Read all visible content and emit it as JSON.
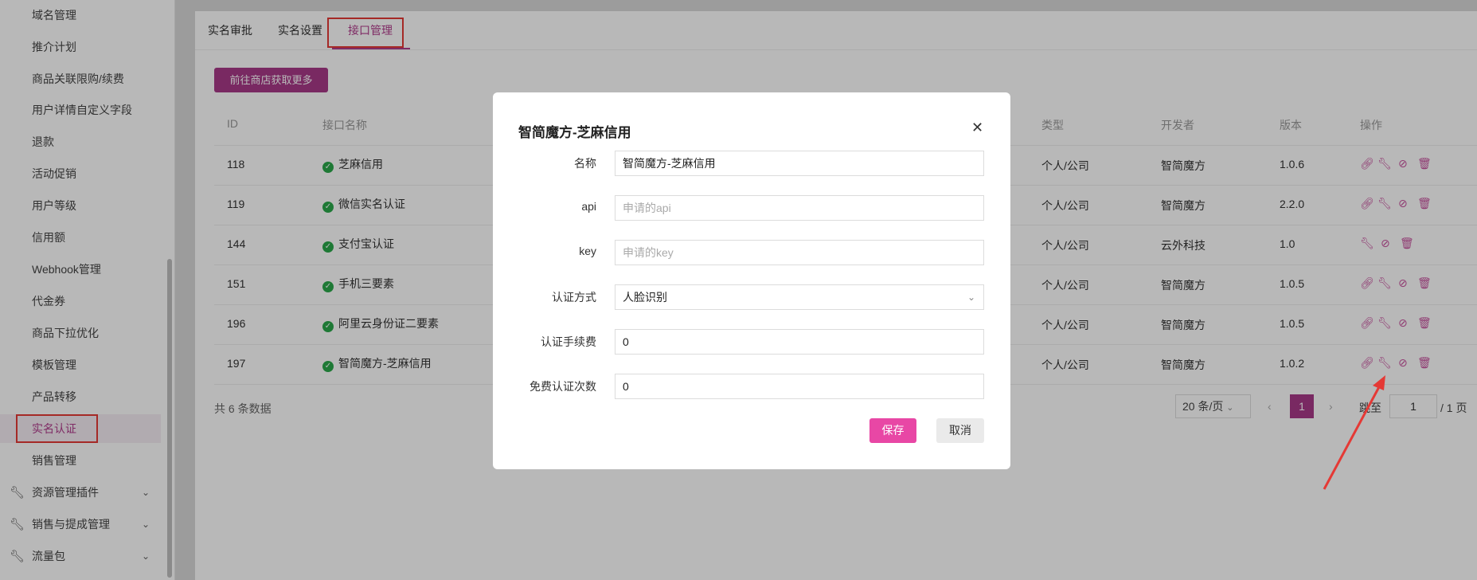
{
  "sidebar": {
    "items": [
      {
        "label": "域名管理"
      },
      {
        "label": "推介计划"
      },
      {
        "label": "商品关联限购/续费"
      },
      {
        "label": "用户详情自定义字段"
      },
      {
        "label": "退款"
      },
      {
        "label": "活动促销"
      },
      {
        "label": "用户等级"
      },
      {
        "label": "信用额"
      },
      {
        "label": "Webhook管理"
      },
      {
        "label": "代金券"
      },
      {
        "label": "商品下拉优化"
      },
      {
        "label": "模板管理"
      },
      {
        "label": "产品转移"
      },
      {
        "label": "实名认证",
        "active": true
      },
      {
        "label": "销售管理"
      }
    ],
    "groups": [
      {
        "label": "资源管理插件",
        "icon": "wrench-icon"
      },
      {
        "label": "销售与提成管理",
        "icon": "wrench-icon"
      },
      {
        "label": "流量包",
        "icon": "wrench-icon"
      }
    ]
  },
  "tabs": [
    {
      "label": "实名审批"
    },
    {
      "label": "实名设置"
    },
    {
      "label": "接口管理",
      "active": true
    }
  ],
  "store_button": "前往商店获取更多",
  "table": {
    "headers": {
      "id": "ID",
      "name": "接口名称",
      "type": "类型",
      "dev": "开发者",
      "version": "版本",
      "ops": "操作"
    },
    "rows": [
      {
        "id": "118",
        "name": "芝麻信用",
        "type": "个人/公司",
        "dev": "智简魔方",
        "version": "1.0.6"
      },
      {
        "id": "119",
        "name": "微信实名认证",
        "type": "个人/公司",
        "dev": "智简魔方",
        "version": "2.2.0"
      },
      {
        "id": "144",
        "name": "支付宝认证",
        "type": "个人/公司",
        "dev": "云外科技",
        "version": "1.0"
      },
      {
        "id": "151",
        "name": "手机三要素",
        "type": "个人/公司",
        "dev": "智简魔方",
        "version": "1.0.5"
      },
      {
        "id": "196",
        "name": "阿里云身份证二要素",
        "type": "个人/公司",
        "dev": "智简魔方",
        "version": "1.0.5"
      },
      {
        "id": "197",
        "name": "智简魔方-芝麻信用",
        "type": "个人/公司",
        "dev": "智简魔方",
        "version": "1.0.2"
      }
    ]
  },
  "pagination": {
    "total_text": "共 6 条数据",
    "page_size": "20 条/页",
    "current": "1",
    "goto_label": "跳至",
    "goto_value": "1",
    "total_pages": "/ 1 页"
  },
  "modal": {
    "title": "智简魔方-芝麻信用",
    "fields": {
      "name_label": "名称",
      "name_value": "智简魔方-芝麻信用",
      "api_label": "api",
      "api_placeholder": "申请的api",
      "key_label": "key",
      "key_placeholder": "申请的key",
      "method_label": "认证方式",
      "method_value": "人脸识别",
      "fee_label": "认证手续费",
      "fee_value": "0",
      "free_label": "免费认证次数",
      "free_value": "0"
    },
    "save": "保存",
    "cancel": "取消"
  },
  "colors": {
    "accent": "#a83a88",
    "save": "#e847a5",
    "annotation": "#e53935"
  }
}
